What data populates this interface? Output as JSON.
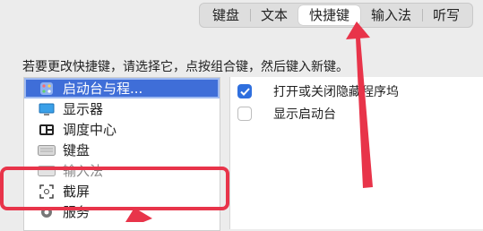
{
  "tabs": [
    {
      "label": "键盘",
      "active": false
    },
    {
      "label": "文本",
      "active": false
    },
    {
      "label": "快捷键",
      "active": true
    },
    {
      "label": "输入法",
      "active": false
    },
    {
      "label": "听写",
      "active": false
    }
  ],
  "instruction": "若要更改快捷键，请选择它，点按组合键，然后键入新键。",
  "sidebar": {
    "items": [
      {
        "label": "启动台与程...",
        "icon": "launchpad-icon",
        "selected": true
      },
      {
        "label": "显示器",
        "icon": "display-icon",
        "selected": false
      },
      {
        "label": "调度中心",
        "icon": "mission-control-icon",
        "selected": false
      },
      {
        "label": "键盘",
        "icon": "keyboard-icon",
        "selected": false
      },
      {
        "label": "输入法",
        "icon": "input-source-icon",
        "selected": false
      },
      {
        "label": "截屏",
        "icon": "screenshot-icon",
        "selected": false
      },
      {
        "label": "服务",
        "icon": "services-gear-icon",
        "selected": false
      }
    ]
  },
  "shortcuts": [
    {
      "label": "打开或关闭隐藏程序坞",
      "checked": true
    },
    {
      "label": "显示启动台",
      "checked": false
    }
  ],
  "colors": {
    "accent": "#3f6ed8",
    "checkbox_on": "#2f6fde",
    "annotation": "#e8344a"
  }
}
